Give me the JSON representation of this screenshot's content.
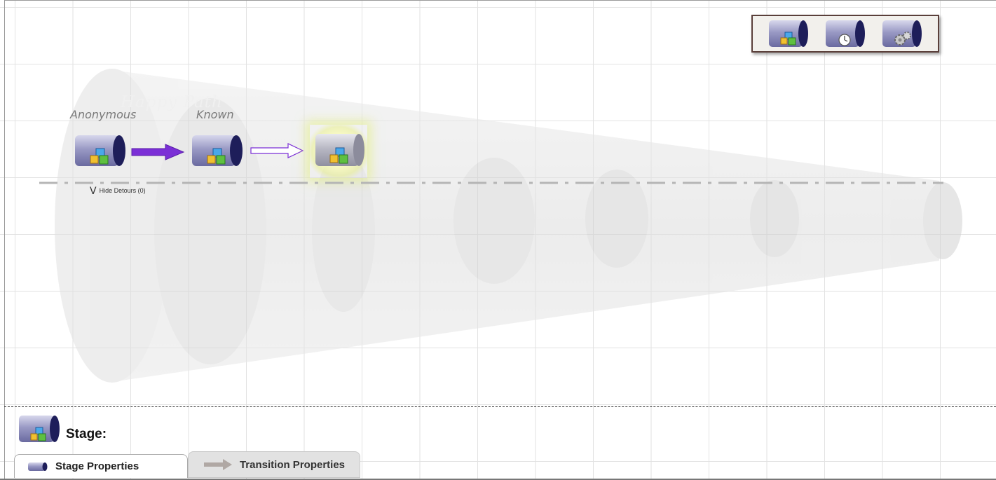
{
  "canvas": {
    "watermark_text": "Happy Path",
    "stages": [
      {
        "label": "Anonymous",
        "icon": "stage-blocks-icon"
      },
      {
        "label": "Known",
        "icon": "stage-blocks-icon"
      },
      {
        "label": "",
        "icon": "stage-blocks-icon",
        "state": "highlighted"
      }
    ],
    "transitions": [
      {
        "icon": "transition-arrow-filled-icon",
        "color": "#7b2fd6"
      },
      {
        "icon": "transition-arrow-outline-icon",
        "color": "#7b2fd6"
      }
    ],
    "hide_detours": {
      "chevron": "V",
      "label": "Hide Detours (0)"
    }
  },
  "toolbox": {
    "items": [
      {
        "icon": "stage-blocks-icon"
      },
      {
        "icon": "stage-clock-icon"
      },
      {
        "icon": "stage-gear-icon"
      }
    ]
  },
  "properties_panel": {
    "heading": "Stage:",
    "tabs": [
      {
        "label": "Stage Properties",
        "icon": "stage-small-icon",
        "active": true
      },
      {
        "label": "Transition Properties",
        "icon": "transition-arrow-gray-icon",
        "active": false
      }
    ]
  },
  "colors": {
    "accent_arrow": "#7b2fd6",
    "highlight_glow": "#e9f08c",
    "toolbox_border": "#5a3f3a"
  }
}
